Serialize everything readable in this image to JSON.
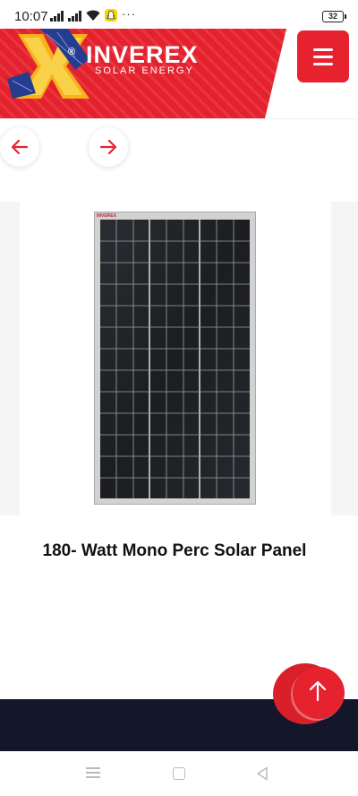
{
  "status_bar": {
    "time": "10:07",
    "battery": "32",
    "overflow_icon": "more-dots-icon",
    "icons": [
      "signal-icon",
      "signal-icon",
      "wifi-icon",
      "snapchat-icon"
    ]
  },
  "header": {
    "brand_name": "INVEREX",
    "brand_tagline": "SOLAR ENERGY",
    "brand_mark": "®",
    "menu_icon": "hamburger-menu-icon",
    "accent_color": "#e6222f"
  },
  "carousel": {
    "prev_icon": "arrow-left-icon",
    "next_icon": "arrow-right-icon"
  },
  "product": {
    "image_label": "INVEREX",
    "title": "180- Watt Mono Perc Solar Panel"
  },
  "scroll_top": {
    "icon": "arrow-up-icon",
    "color": "#e6222f"
  },
  "footer": {
    "color": "#14172a"
  },
  "nav_bar": {
    "recents_icon": "recents-icon",
    "home_icon": "home-icon",
    "back_icon": "back-icon"
  }
}
